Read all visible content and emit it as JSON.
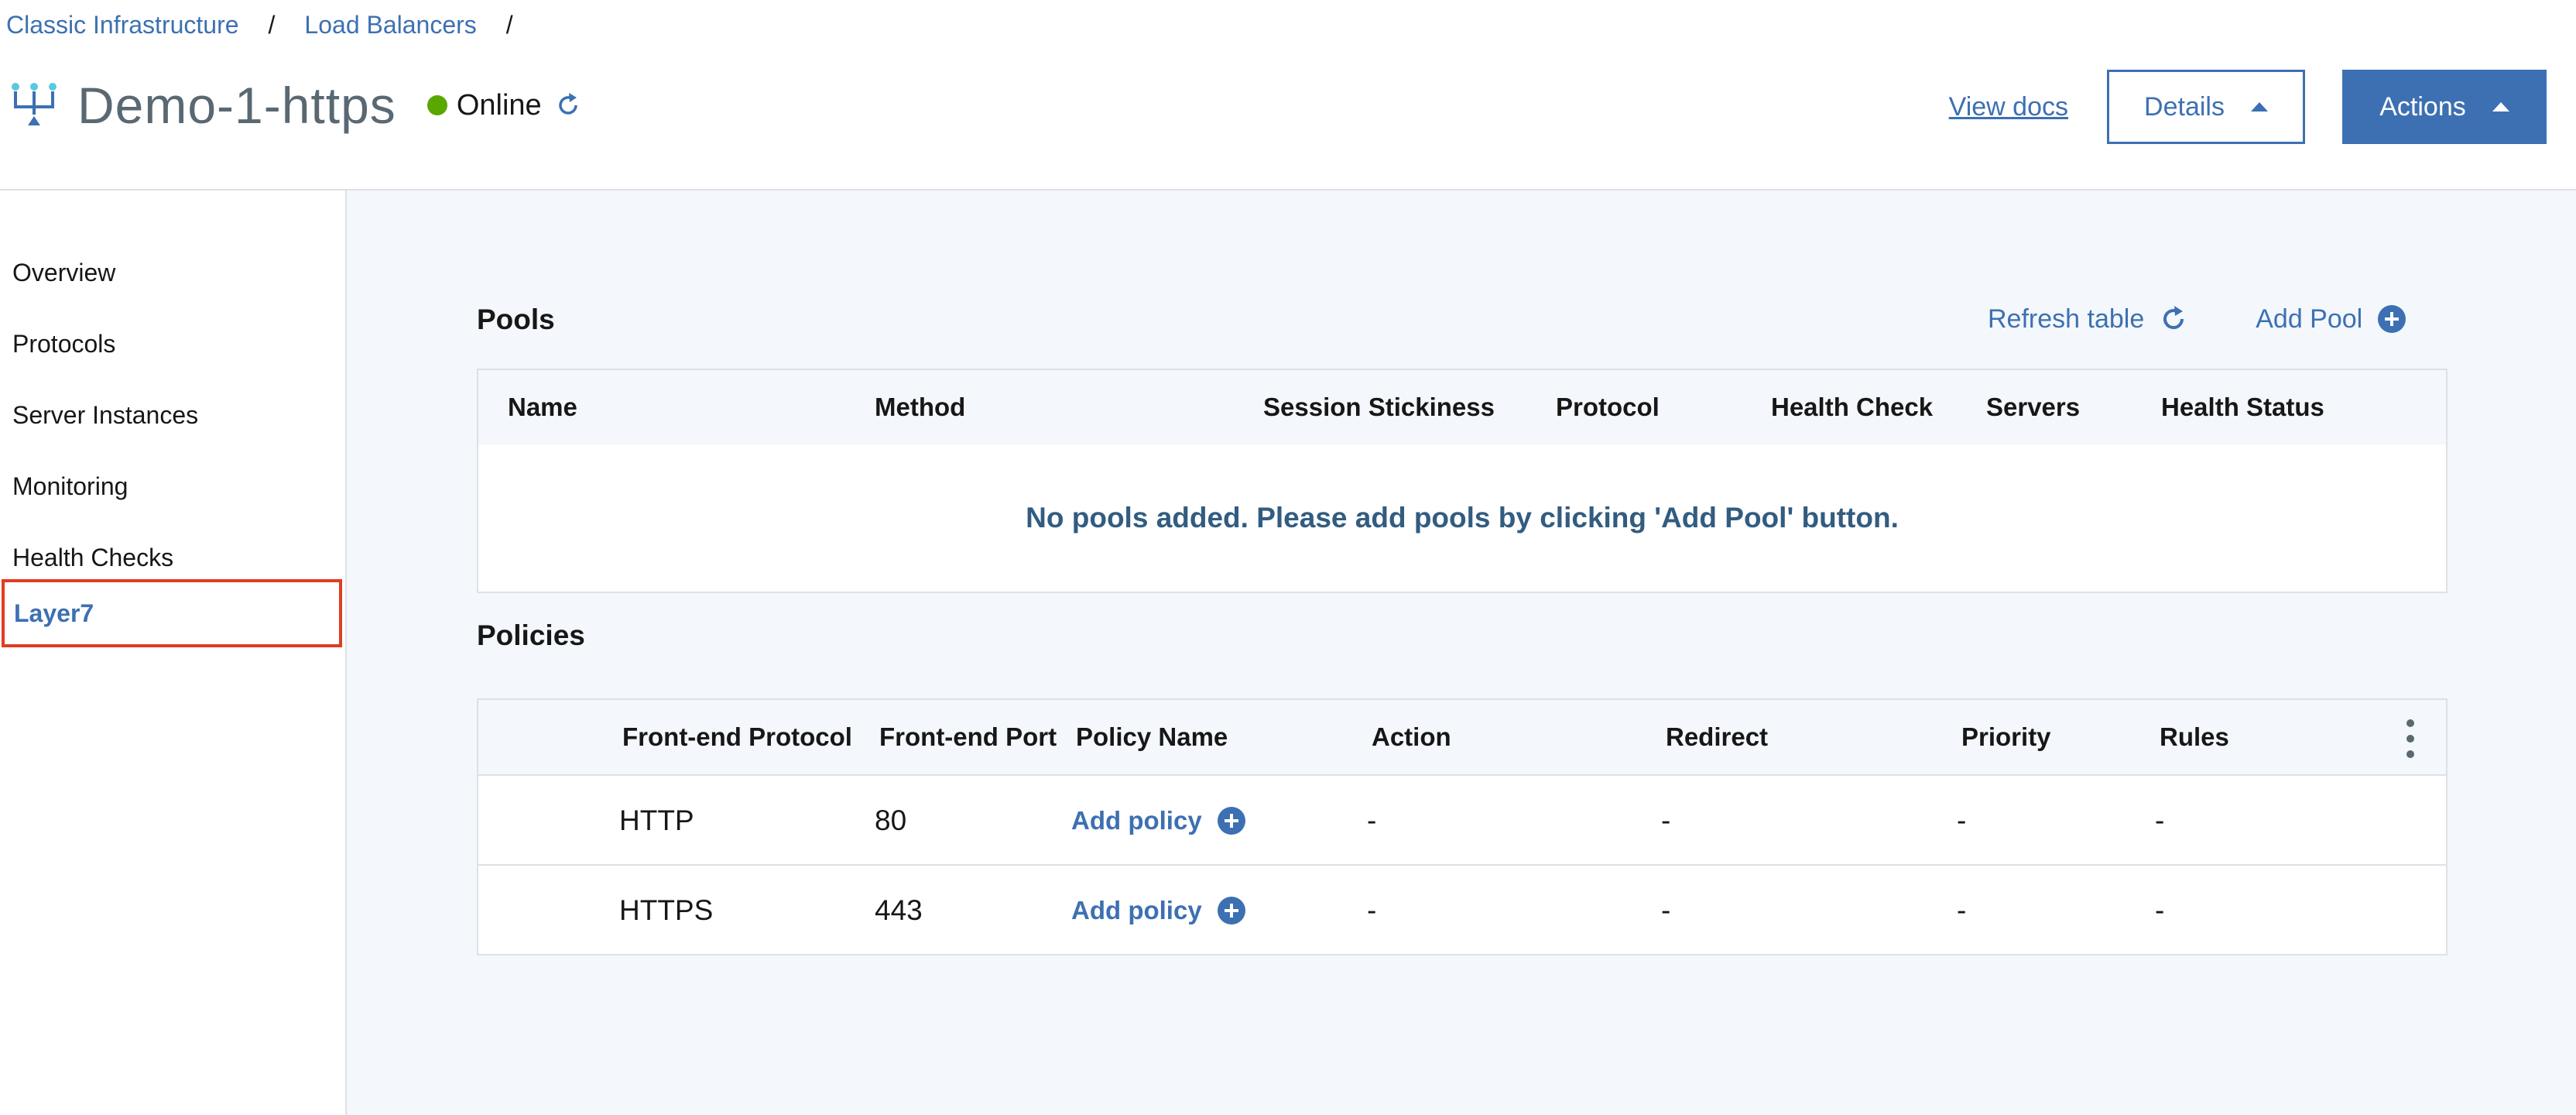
{
  "breadcrumb": {
    "items": [
      "Classic Infrastructure",
      "Load Balancers"
    ],
    "separator": "/"
  },
  "header": {
    "icon": "load-balancer-icon",
    "title": "Demo-1-https",
    "status": "Online",
    "status_color": "#5aa700",
    "view_docs": "View docs",
    "details_label": "Details",
    "actions_label": "Actions"
  },
  "sidebar": {
    "items": [
      {
        "label": "Overview",
        "active": false
      },
      {
        "label": "Protocols",
        "active": false
      },
      {
        "label": "Server Instances",
        "active": false
      },
      {
        "label": "Monitoring",
        "active": false
      },
      {
        "label": "Health Checks",
        "active": false
      },
      {
        "label": "Layer7",
        "active": true
      }
    ]
  },
  "pools": {
    "title": "Pools",
    "refresh_label": "Refresh table",
    "add_label": "Add Pool",
    "columns": [
      "Name",
      "Method",
      "Session Stickiness",
      "Protocol",
      "Health Check",
      "Servers",
      "Health Status"
    ],
    "empty_message": "No pools added. Please add pools by clicking 'Add Pool' button."
  },
  "policies": {
    "title": "Policies",
    "columns": [
      "Front-end Protocol",
      "Front-end Port",
      "Policy Name",
      "Action",
      "Redirect",
      "Priority",
      "Rules"
    ],
    "rows": [
      {
        "protocol": "HTTP",
        "port": "80",
        "policy": "Add policy",
        "action": "-",
        "redirect": "-",
        "priority": "-",
        "rules": "-"
      },
      {
        "protocol": "HTTPS",
        "port": "443",
        "policy": "Add policy",
        "action": "-",
        "redirect": "-",
        "priority": "-",
        "rules": "-"
      }
    ]
  },
  "colors": {
    "accent": "#3d70b2",
    "highlight_border": "#e23c21",
    "empty_text": "#325c80",
    "background": "#f4f7fb"
  }
}
